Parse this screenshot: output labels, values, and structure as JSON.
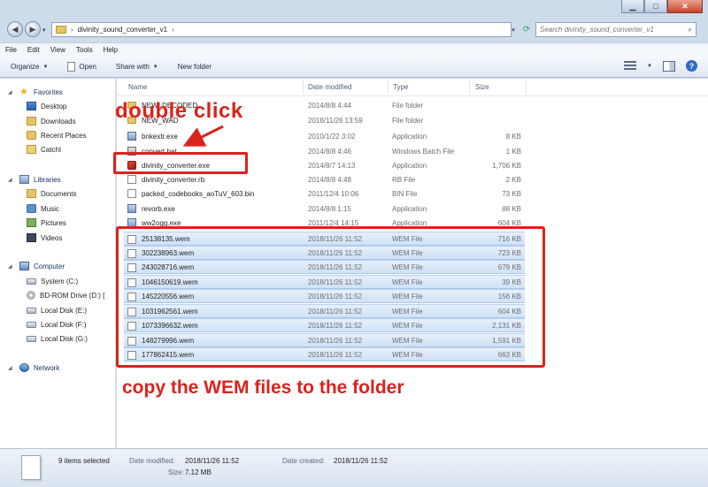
{
  "address": {
    "path": "divinity_sound_converter_v1",
    "search_placeholder": "Search divinity_sound_converter_v1"
  },
  "menu": [
    "File",
    "Edit",
    "View",
    "Tools",
    "Help"
  ],
  "toolbar": {
    "organize": "Organize",
    "open": "Open",
    "share_with": "Share with",
    "new_folder": "New folder"
  },
  "nav": {
    "favorites": "Favorites",
    "desktop": "Desktop",
    "downloads": "Downloads",
    "recent": "Recent Places",
    "user": "CatchI",
    "libraries": "Libraries",
    "documents": "Documents",
    "music": "Music",
    "pictures": "Pictures",
    "videos": "Videos",
    "computer": "Computer",
    "system": "System (C:)",
    "bd": "BD-ROM Drive (D:) [",
    "local_e": "Local Disk (E:)",
    "local_f": "Local Disk (F:)",
    "local_g": "Local Disk (G:)",
    "network": "Network"
  },
  "columns": {
    "name": "Name",
    "date": "Date modified",
    "type": "Type",
    "size": "Size"
  },
  "files": [
    {
      "name": "NEW_DECODED",
      "date": "2014/8/8 4:44",
      "type": "File folder",
      "size": ""
    },
    {
      "name": "NEW_WAD",
      "date": "2018/11/26 13:59",
      "type": "File folder",
      "size": ""
    },
    {
      "name": "bnkextr.exe",
      "date": "2010/1/22 3:02",
      "type": "Application",
      "size": "8 KB"
    },
    {
      "name": "convert.bat",
      "date": "2014/8/8 4:46",
      "type": "Windows Batch File",
      "size": "1 KB"
    },
    {
      "name": "divinity_converter.exe",
      "date": "2014/8/7 14:13",
      "type": "Application",
      "size": "1,706 KB"
    },
    {
      "name": "divinity_converter.rb",
      "date": "2014/8/8 4:48",
      "type": "RB File",
      "size": "2 KB"
    },
    {
      "name": "packed_codebooks_aoTuV_603.bin",
      "date": "2011/12/4 10:06",
      "type": "BIN File",
      "size": "73 KB"
    },
    {
      "name": "revorb.exe",
      "date": "2014/8/8 1:15",
      "type": "Application",
      "size": "88 KB"
    },
    {
      "name": "ww2ogg.exe",
      "date": "2011/12/4 14:15",
      "type": "Application",
      "size": "604 KB"
    },
    {
      "name": "25138135.wem",
      "date": "2018/11/26 11:52",
      "type": "WEM File",
      "size": "716 KB"
    },
    {
      "name": "302238963.wem",
      "date": "2018/11/26 11:52",
      "type": "WEM File",
      "size": "723 KB"
    },
    {
      "name": "243028716.wem",
      "date": "2018/11/26 11:52",
      "type": "WEM File",
      "size": "679 KB"
    },
    {
      "name": "1046150619.wem",
      "date": "2018/11/26 11:52",
      "type": "WEM File",
      "size": "39 KB"
    },
    {
      "name": "145220556.wem",
      "date": "2018/11/26 11:52",
      "type": "WEM File",
      "size": "156 KB"
    },
    {
      "name": "1031962561.wem",
      "date": "2018/11/26 11:52",
      "type": "WEM File",
      "size": "604 KB"
    },
    {
      "name": "1073396632.wem",
      "date": "2018/11/26 11:52",
      "type": "WEM File",
      "size": "2,131 KB"
    },
    {
      "name": "148279996.wem",
      "date": "2018/11/26 11:52",
      "type": "WEM File",
      "size": "1,591 KB"
    },
    {
      "name": "177862415.wem",
      "date": "2018/11/26 11:52",
      "type": "WEM File",
      "size": "663 KB"
    }
  ],
  "annotations": {
    "double_click": "double click",
    "copy_note": "copy the WEM files to the folder",
    "color": "#d9231c"
  },
  "details": {
    "count": "9 items selected",
    "modified_label": "Date modified:",
    "modified_value": "2018/11/26 11:52",
    "size_label": "Size:",
    "size_value": "7.12 MB",
    "created_label": "Date created:",
    "created_value": "2018/11/26 11:52"
  }
}
